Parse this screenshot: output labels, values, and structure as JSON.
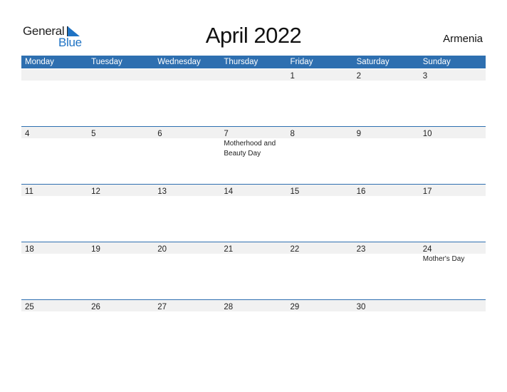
{
  "brand": {
    "word1": "General",
    "word2": "Blue",
    "color": "#1f73c4"
  },
  "title": "April 2022",
  "country": "Armenia",
  "colors": {
    "header_bg": "#2e6fb0",
    "date_strip_bg": "#f1f1f1"
  },
  "weekdays": [
    "Monday",
    "Tuesday",
    "Wednesday",
    "Thursday",
    "Friday",
    "Saturday",
    "Sunday"
  ],
  "weeks": [
    {
      "days": [
        "",
        "",
        "",
        "",
        "1",
        "2",
        "3"
      ],
      "events": [
        "",
        "",
        "",
        "",
        "",
        "",
        ""
      ]
    },
    {
      "days": [
        "4",
        "5",
        "6",
        "7",
        "8",
        "9",
        "10"
      ],
      "events": [
        "",
        "",
        "",
        "Motherhood and Beauty Day",
        "",
        "",
        ""
      ]
    },
    {
      "days": [
        "11",
        "12",
        "13",
        "14",
        "15",
        "16",
        "17"
      ],
      "events": [
        "",
        "",
        "",
        "",
        "",
        "",
        ""
      ]
    },
    {
      "days": [
        "18",
        "19",
        "20",
        "21",
        "22",
        "23",
        "24"
      ],
      "events": [
        "",
        "",
        "",
        "",
        "",
        "",
        "Mother's Day"
      ]
    },
    {
      "days": [
        "25",
        "26",
        "27",
        "28",
        "29",
        "30",
        ""
      ],
      "events": [
        "",
        "",
        "",
        "",
        "",
        "",
        ""
      ]
    }
  ]
}
